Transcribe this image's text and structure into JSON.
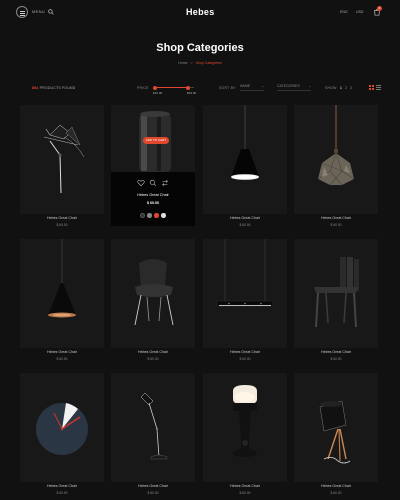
{
  "header": {
    "menu_label": "MENU",
    "logo": "Hebes",
    "links": [
      "ENG",
      "USD"
    ],
    "cart_count": "0"
  },
  "page": {
    "title": "Shop Categories",
    "breadcrumb": [
      "Home",
      "Shop Categories"
    ]
  },
  "filters": {
    "found_count": "864",
    "found_label": "PRODUCTS FOUND",
    "price_label": "PRICE",
    "price_range": {
      "min_display": "$10.00",
      "max_display": "$99.00",
      "min_fraction": 0.05,
      "max_fraction": 0.85
    },
    "sort_label": "SORT BY",
    "sort_value": "NAME",
    "category_value": "CATEGORIES",
    "show_label": "SHOW",
    "show_options": [
      "1",
      "2",
      "3"
    ],
    "show_selected": "1"
  },
  "products": [
    {
      "name": "Hebes Great Chair",
      "price": "$ 60.00",
      "image": "desk-lamp-angled"
    },
    {
      "name": "Hebes Great Chair",
      "price": "$ 60.00",
      "image": "cylinder-lamp"
    },
    {
      "name": "Hebes Great Chair",
      "price": "$ 60.00",
      "image": "pendant-cone-black"
    },
    {
      "name": "Hebes Great Chair",
      "price": "$ 60.00",
      "image": "pendant-stone-geometric"
    },
    {
      "name": "Hebes Great Chair",
      "price": "$ 60.00",
      "image": "pendant-cone-copper"
    },
    {
      "name": "Hebes Great Chair",
      "price": "$ 60.00",
      "image": "shell-chair"
    },
    {
      "name": "Hebes Great Chair",
      "price": "$ 60.00",
      "image": "linear-pendant"
    },
    {
      "name": "Hebes Great Chair",
      "price": "$ 60.00",
      "image": "slatted-chair"
    },
    {
      "name": "Hebes Great Chair",
      "price": "$ 60.00",
      "image": "wall-clock"
    },
    {
      "name": "Hebes Great Chair",
      "price": "$ 60.00",
      "image": "floor-lamp-black"
    },
    {
      "name": "Hebes Great Chair",
      "price": "$ 60.00",
      "image": "table-lamp-glow"
    },
    {
      "name": "Hebes Great Chair",
      "price": "$ 60.00",
      "image": "tripod-lamp"
    }
  ],
  "quick_view": {
    "name": "Hebes Great Chair",
    "price": "$ 60.00",
    "add_to_cart": "ADD TO CART",
    "icons": [
      "heart-icon",
      "search-icon",
      "compare-icon"
    ],
    "swatches": [
      "#333333",
      "#888888",
      "#e0472d",
      "#dddddd"
    ]
  },
  "colors": {
    "accent": "#e0472d",
    "background": "#111111",
    "card": "#181818"
  }
}
